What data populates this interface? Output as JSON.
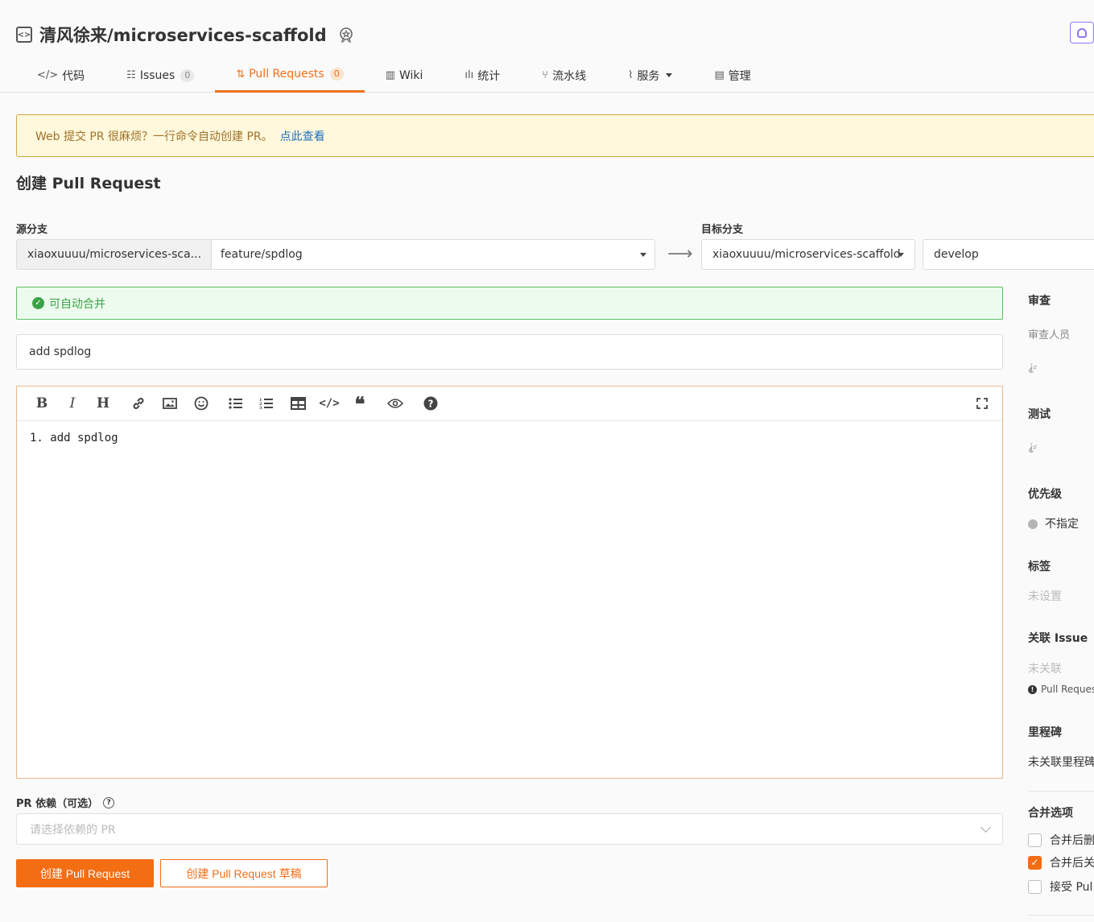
{
  "repo": {
    "title": "清风徐来/microservices-scaffold"
  },
  "tabs": [
    {
      "icon": "</>",
      "label": "代码",
      "count": ""
    },
    {
      "icon": "☷",
      "label": "Issues",
      "count": "0"
    },
    {
      "icon": "⇅",
      "label": "Pull Requests",
      "count": "0"
    },
    {
      "icon": "▥",
      "label": "Wiki",
      "count": ""
    },
    {
      "icon": "ılı",
      "label": "统计",
      "count": ""
    },
    {
      "icon": "⑂",
      "label": "流水线",
      "count": ""
    },
    {
      "icon": "⌇",
      "label": "服务",
      "count": ""
    },
    {
      "icon": "▤",
      "label": "管理",
      "count": ""
    }
  ],
  "notice": {
    "text": "Web 提交 PR 很麻烦？一行命令自动创建 PR。",
    "link": "点此查看"
  },
  "form": {
    "page_title": "创建 Pull Request",
    "source_label": "源分支",
    "target_label": "目标分支",
    "source_repo": "xiaoxuuuu/microservices-sca...",
    "source_branch": "feature/spdlog",
    "target_repo": "xiaoxuuuu/microservices-scaffold",
    "target_branch": "develop",
    "merge_status": "可自动合并",
    "title_value": "add spdlog",
    "body_text": "1. add spdlog",
    "dep_label": "PR 依赖（可选）",
    "dep_placeholder": "请选择依赖的 PR",
    "create_button": "创建 Pull Request",
    "draft_button": "创建 Pull Request 草稿"
  },
  "toolbar": [
    "bold-icon",
    "italic-icon",
    "heading-icon",
    "link-icon",
    "image-icon",
    "emoji-icon",
    "bullet-list-icon",
    "numbered-list-icon",
    "table-icon",
    "code-icon",
    "quote-icon",
    "preview-icon",
    "help-icon",
    "fullscreen-icon"
  ],
  "sidebar": {
    "review_head": "审查",
    "reviewers_label": "审查人员",
    "test_head": "测试",
    "priority_head": "优先级",
    "priority_value": "不指定",
    "labels_head": "标签",
    "labels_value": "未设置",
    "issue_head": "关联 Issue",
    "issue_value": "未关联",
    "issue_note": "Pull Reques",
    "milestone_head": "里程碑",
    "milestone_value": "未关联里程碑",
    "merge_head": "合并选项",
    "opt1": "合并后删",
    "opt2": "合并后关",
    "opt3": "接受 Pul"
  },
  "colors": {
    "accent": "#f36d13",
    "success": "#3aa347",
    "notice_bg": "#fff8dc"
  }
}
